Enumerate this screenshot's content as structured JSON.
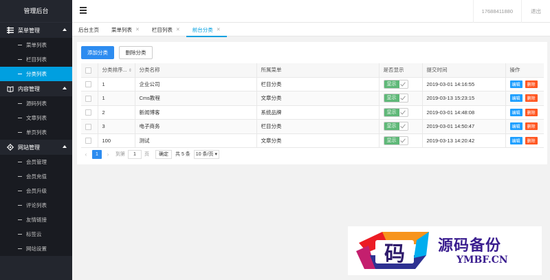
{
  "sidebar": {
    "title": "管理后台",
    "groups": [
      {
        "label": "菜单管理",
        "items": [
          {
            "label": "菜单列表"
          },
          {
            "label": "栏目列表"
          },
          {
            "label": "分类列表"
          }
        ]
      },
      {
        "label": "内容管理",
        "items": [
          {
            "label": "源码列表"
          },
          {
            "label": "文章列表"
          },
          {
            "label": "单页列表"
          }
        ]
      },
      {
        "label": "网站管理",
        "items": [
          {
            "label": "会员管理"
          },
          {
            "label": "会员充值"
          },
          {
            "label": "会员升级"
          },
          {
            "label": "评论列表"
          },
          {
            "label": "友情链接"
          },
          {
            "label": "标签云"
          },
          {
            "label": "网站设置"
          }
        ]
      }
    ],
    "active_item": "分类列表"
  },
  "header": {
    "phone": "17688411880",
    "logout": "退出"
  },
  "tabs": [
    {
      "label": "后台主页",
      "closable": false
    },
    {
      "label": "菜单列表",
      "closable": true
    },
    {
      "label": "栏目列表",
      "closable": true
    },
    {
      "label": "前台分类",
      "closable": true,
      "active": true
    }
  ],
  "toolbar": {
    "add_label": "添加分类",
    "delete_label": "删除分类"
  },
  "table": {
    "columns": [
      "分类排序...",
      "分类名称",
      "所属菜单",
      "是否显示",
      "提交时间",
      "操作"
    ],
    "rows": [
      {
        "order": "1",
        "name": "企业公司",
        "menu": "栏目分类",
        "show": "显示",
        "time": "2019-03-01 14:16:55"
      },
      {
        "order": "1",
        "name": "Cms教程",
        "menu": "文章分类",
        "show": "显示",
        "time": "2019-03-13 15:23:15"
      },
      {
        "order": "2",
        "name": "新闻博客",
        "menu": "系统品牌",
        "show": "显示",
        "time": "2019-03-01 14:48:08"
      },
      {
        "order": "3",
        "name": "电子商务",
        "menu": "栏目分类",
        "show": "显示",
        "time": "2019-03-01 14:50:47"
      },
      {
        "order": "100",
        "name": "测试",
        "menu": "文章分类",
        "show": "显示",
        "time": "2019-03-13 14:20:42"
      }
    ],
    "edit_label": "编辑",
    "delete_label": "删除"
  },
  "pager": {
    "prev": "‹",
    "current": "1",
    "next": "›",
    "goto_label": "到第",
    "goto_value": "1",
    "page_label": "页",
    "confirm": "确定",
    "total": "共 5 条",
    "page_size": "10 条/页"
  },
  "watermark": {
    "cn": "源码备份",
    "en": "YMBF.CN",
    "glyph": "码"
  }
}
